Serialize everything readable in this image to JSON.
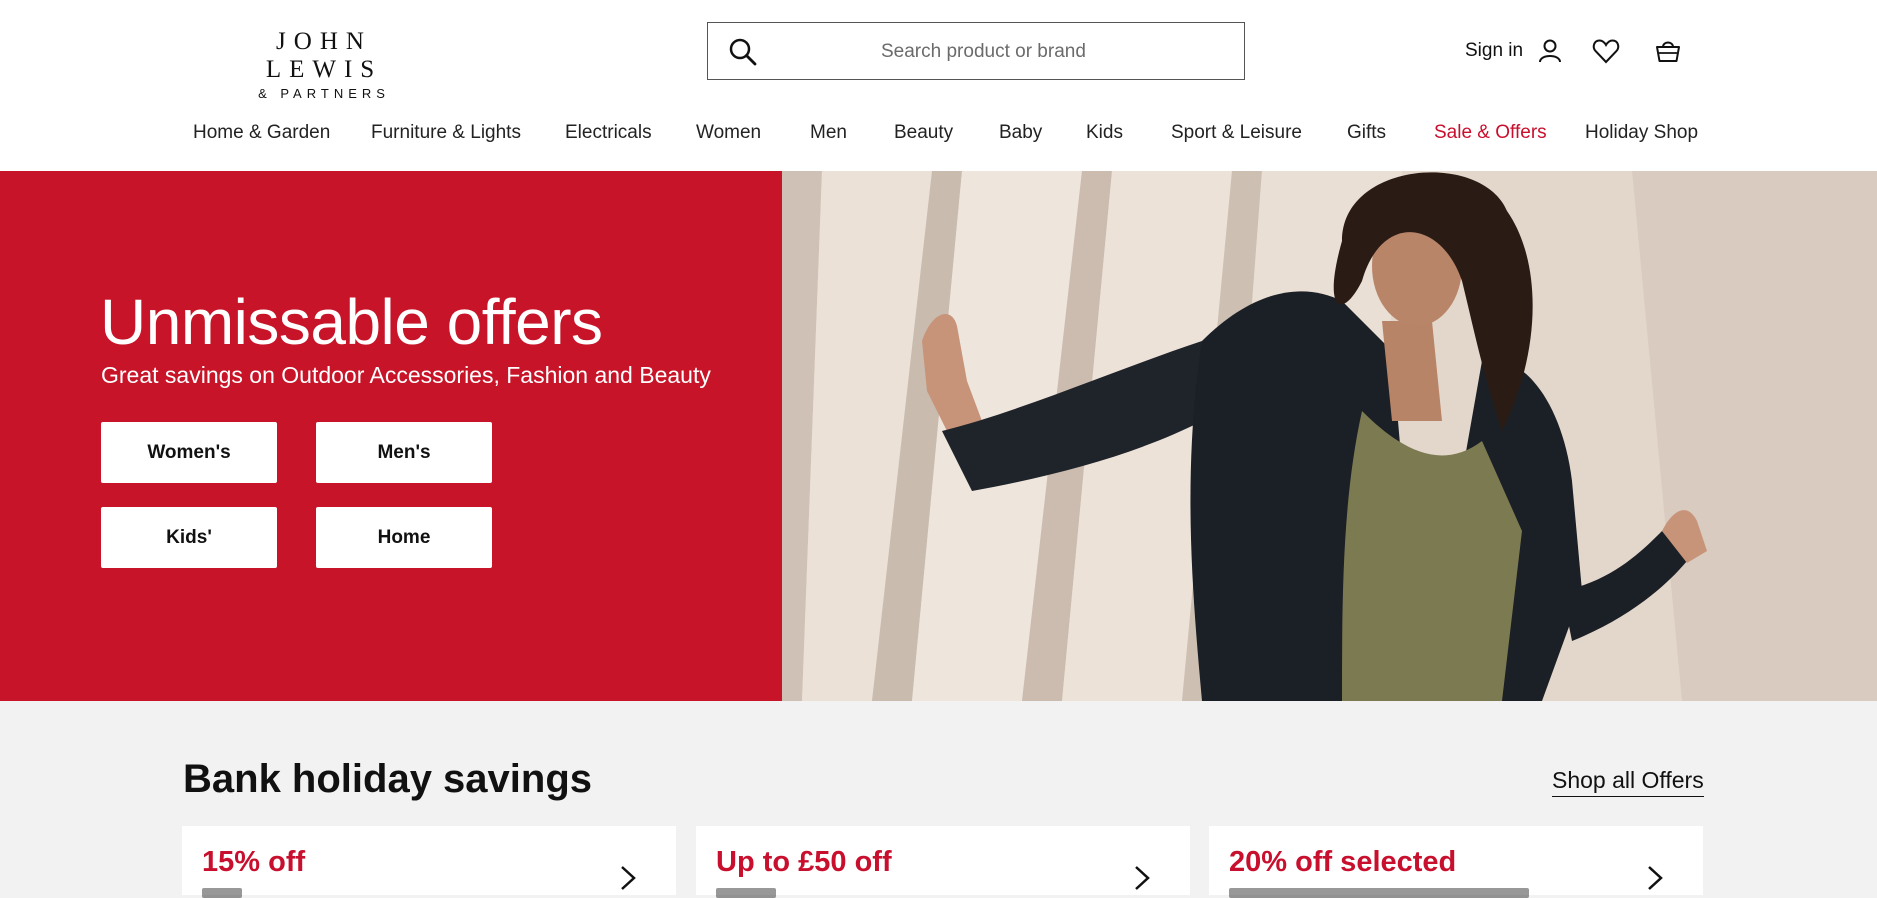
{
  "brand": {
    "line1": "JOHN LEWIS",
    "line2": "& PARTNERS"
  },
  "search": {
    "placeholder": "Search product or brand"
  },
  "account": {
    "sign_in": "Sign in"
  },
  "nav": [
    "Home & Garden",
    "Furniture & Lights",
    "Electricals",
    "Women",
    "Men",
    "Beauty",
    "Baby",
    "Kids",
    "Sport & Leisure",
    "Gifts",
    "Sale & Offers",
    "Holiday Shop"
  ],
  "hero": {
    "title": "Unmissable offers",
    "subtitle": "Great savings on Outdoor Accessories, Fashion and Beauty",
    "buttons": [
      "Women's",
      "Men's",
      "Kids'",
      "Home"
    ],
    "bg_color": "#c81428"
  },
  "offers_section": {
    "title": "Bank holiday savings",
    "shop_all": "Shop all Offers",
    "cards": [
      {
        "title": "15% off"
      },
      {
        "title": "Up to £50 off"
      },
      {
        "title": "20% off selected"
      }
    ]
  },
  "icons": [
    "search-icon",
    "user-icon",
    "heart-icon",
    "basket-icon",
    "chevron-right-icon"
  ],
  "colors": {
    "accent_red": "#c8102e",
    "page_bg": "#f2f2f2"
  }
}
